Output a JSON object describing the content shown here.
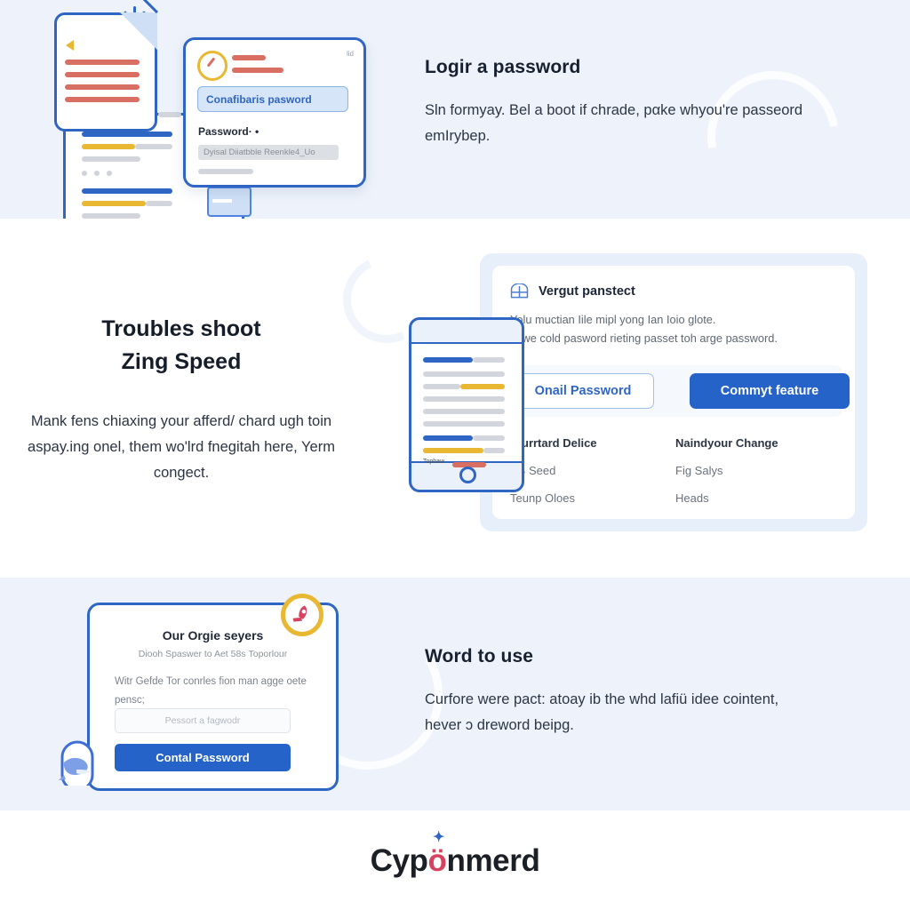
{
  "theme": {
    "accent_blue": "#2563c9",
    "line_blue": "#2f66c4",
    "band_bg": "#eef3fb",
    "gold": "#e9b832",
    "red": "#d96f62",
    "logo_accent": "#d7435f"
  },
  "section1": {
    "heading": "Logir a password",
    "body": "Sln formyay. Bel a boot if chrade, pαke whyou're passeord emIrybep.",
    "illustration": {
      "field_value": "Conafibaris pasword",
      "label": "Password· •",
      "hint_text": "Dyisal Diiatbble Reenkle4_Uo",
      "badge": "lid"
    }
  },
  "section2": {
    "heading_line1": "Troubles shoot",
    "heading_line2": "Zing Speed",
    "body": "Mank fens chiaxing your afferd/ chard ugh toin aspay.ing onel, them wo'lrd fnegitah here, Yerm congect.",
    "panel": {
      "title": "Vergut panstect",
      "body_line1": "Yolu muctian Iile mipl yong Ian Ioio glote.",
      "body_line2": "le we cold pasword rieting passet toh arge password.",
      "button_secondary": "Onаil Password",
      "button_primary": "Commyt feature",
      "columns": [
        {
          "header": "Sturrtard Delice",
          "items": [
            "AB Seed",
            "Teunp Oloes"
          ]
        },
        {
          "header": "Naindyour Change",
          "items": [
            "Fig Salys",
            "Heads"
          ]
        }
      ]
    }
  },
  "section3": {
    "heading": "Word to use",
    "body": "Curfore were pact: atoay ib the whd lafiü idee cointent, hever ɔ dreword beipg.",
    "card": {
      "title": "Our Orgie seyers",
      "subtitle": "Diooh Spaswer to Aet 58ѕ Toporlour",
      "paragraph": "Witr Gefde Tor conrles fion man agge oete pensc;",
      "input_placeholder": "Pessort a fagwodr",
      "button": "Contal Password"
    }
  },
  "footer": {
    "logo_part1": "Cyp",
    "logo_accent": "ö",
    "logo_part2": "nmerd"
  }
}
